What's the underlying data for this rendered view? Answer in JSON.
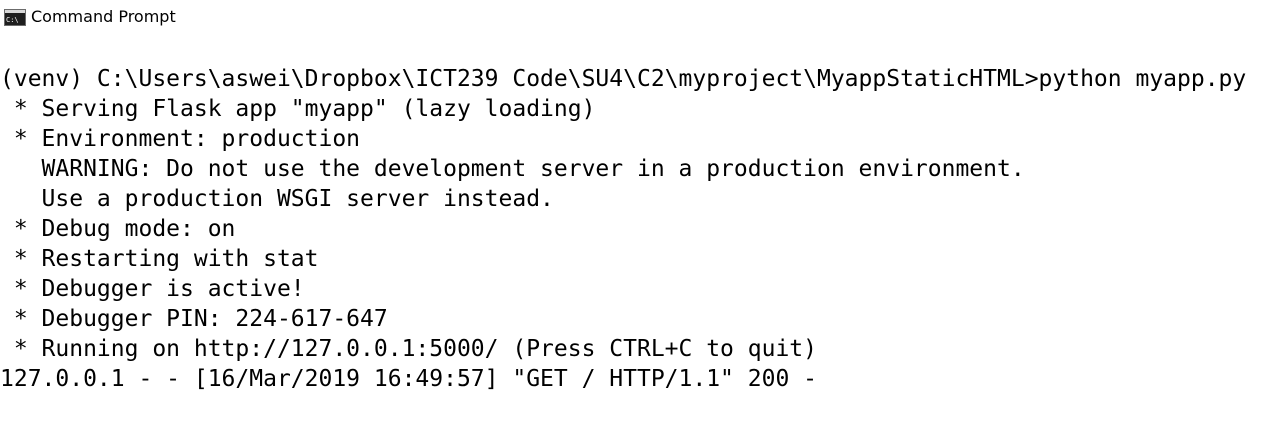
{
  "window": {
    "title": "Command Prompt",
    "icon": "console-icon"
  },
  "console": {
    "lines": [
      "(venv) C:\\Users\\aswei\\Dropbox\\ICT239 Code\\SU4\\C2\\myproject\\MyappStaticHTML>python myapp.py",
      " * Serving Flask app \"myapp\" (lazy loading)",
      " * Environment: production",
      "   WARNING: Do not use the development server in a production environment.",
      "   Use a production WSGI server instead.",
      " * Debug mode: on",
      " * Restarting with stat",
      " * Debugger is active!",
      " * Debugger PIN: 224-617-647",
      " * Running on http://127.0.0.1:5000/ (Press CTRL+C to quit)",
      "127.0.0.1 - - [16/Mar/2019 16:49:57] \"GET / HTTP/1.1\" 200 -"
    ]
  },
  "colors": {
    "background": "#ffffff",
    "text": "#000000"
  }
}
